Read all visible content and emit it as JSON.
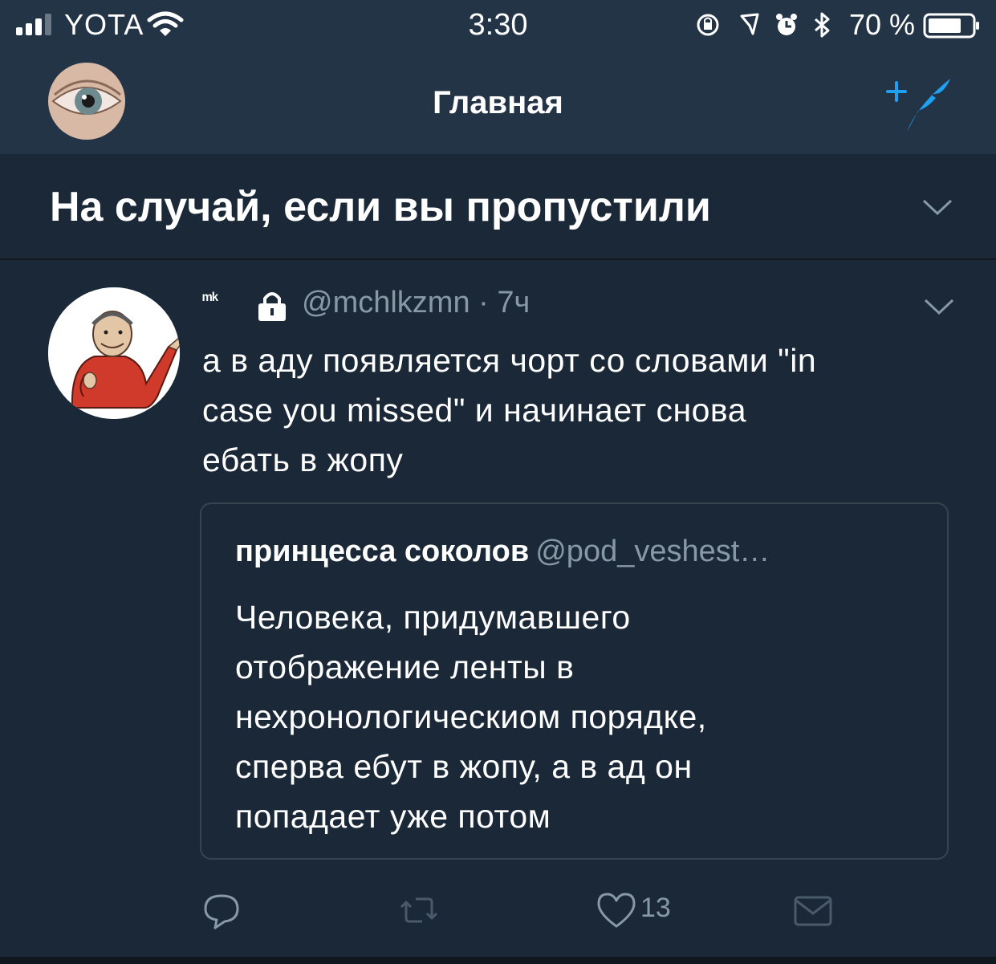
{
  "status_bar": {
    "carrier": "YOTA",
    "time": "3:30",
    "battery_percent": "70 %"
  },
  "nav": {
    "title": "Главная"
  },
  "section": {
    "title": "На случай, если вы пропустили"
  },
  "tweet": {
    "author_name": "ᵐᵏ",
    "handle_and_time": "@mchlkzmn · 7ч",
    "text": "а в аду появляется чорт со словами \"in\ncase you missed\" и начинает снова\nебать в жопу",
    "quote": {
      "author_name": "принцесса соколов",
      "author_handle": "@pod_veshest…",
      "text": "Человека, придумавшего\nотображение ленты в\nнехронологическиом порядке,\nсперва ебут в жопу, а в ад он\nпопадает уже потом"
    },
    "actions": {
      "like_count": "13"
    }
  },
  "colors": {
    "background": "#1b2837",
    "bar": "#243447",
    "secondary_text": "#8899a6",
    "accent": "#1da1f2",
    "border": "#38444d"
  }
}
